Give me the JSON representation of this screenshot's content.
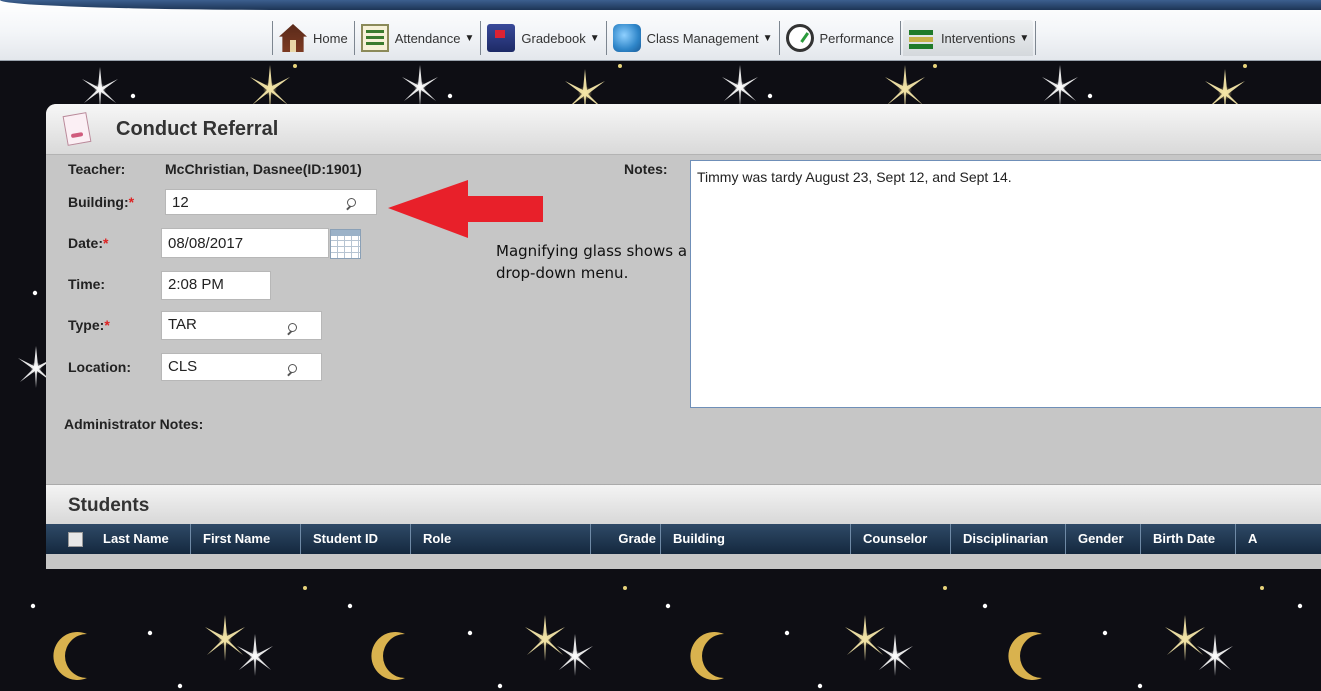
{
  "nav": {
    "items": [
      {
        "label": "Home",
        "icon": "home-icon",
        "has_menu": false
      },
      {
        "label": "Attendance",
        "icon": "attendance-icon",
        "has_menu": true
      },
      {
        "label": "Gradebook",
        "icon": "gradebook-icon",
        "has_menu": true
      },
      {
        "label": "Class Management",
        "icon": "class-management-icon",
        "has_menu": true
      },
      {
        "label": "Performance",
        "icon": "performance-icon",
        "has_menu": false
      },
      {
        "label": "Interventions",
        "icon": "interventions-icon",
        "has_menu": true
      }
    ],
    "caret": "▼",
    "active": "Interventions"
  },
  "panel": {
    "title": "Conduct Referral"
  },
  "form": {
    "teacher_label": "Teacher:",
    "teacher_value": "McChristian, Dasnee(ID:1901)",
    "building_label": "Building:",
    "building_value": "12",
    "date_label": "Date:",
    "date_value": "08/08/2017",
    "time_label": "Time:",
    "time_value": "2:08 PM",
    "type_label": "Type:",
    "type_value": "TAR",
    "location_label": "Location:",
    "location_value": "CLS",
    "required_marker": "*",
    "notes_label": "Notes:",
    "notes_value": "Timmy was tardy August 23, Sept 12, and Sept 14.",
    "admin_notes_label": "Administrator Notes:"
  },
  "students": {
    "title": "Students",
    "columns": [
      "Last Name",
      "First Name",
      "Student ID",
      "Role",
      "Grade",
      "Building",
      "Counselor",
      "Disciplinarian",
      "Gender",
      "Birth Date",
      "A"
    ]
  },
  "annotation": {
    "line1": "Magnifying glass shows a",
    "line2": "drop-down menu.",
    "arrow_color": "#e8202a"
  },
  "colors": {
    "grid_header": "#1d344e",
    "required": "#dd2222",
    "notes_border": "#6f8fb8"
  }
}
